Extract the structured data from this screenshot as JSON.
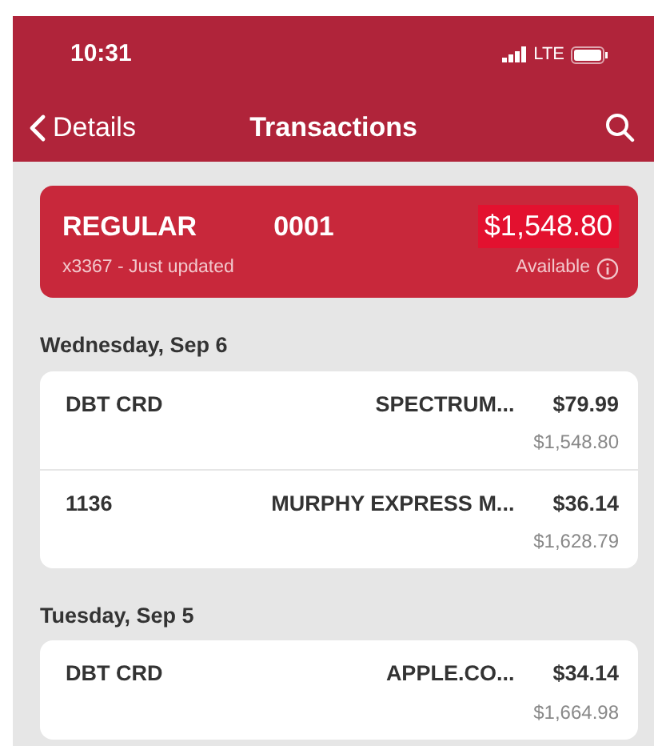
{
  "status_bar": {
    "time": "10:31",
    "network": "LTE"
  },
  "nav": {
    "back_label": "Details",
    "title": "Transactions"
  },
  "account": {
    "name": "REGULAR",
    "number": "0001",
    "balance": "$1,548.80",
    "subtitle": "x3367 - Just updated",
    "balance_label": "Available"
  },
  "days": [
    {
      "date": "Wednesday, Sep 6",
      "transactions": [
        {
          "type": "DBT CRD",
          "merchant": "SPECTRUM...",
          "amount": "$79.99",
          "balance": "$1,548.80"
        },
        {
          "type": "1136",
          "merchant": "MURPHY EXPRESS M...",
          "amount": "$36.14",
          "balance": "$1,628.79"
        }
      ]
    },
    {
      "date": "Tuesday, Sep 5",
      "transactions": [
        {
          "type": "DBT CRD",
          "merchant": "APPLE.CO...",
          "amount": "$34.14",
          "balance": "$1,664.98"
        }
      ]
    }
  ]
}
